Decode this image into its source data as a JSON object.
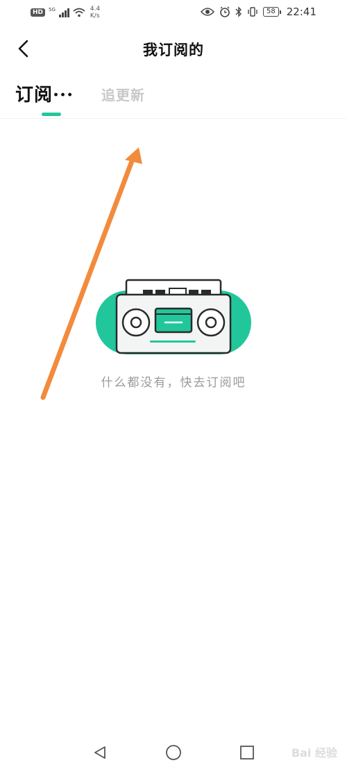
{
  "status_bar": {
    "hd": "HD",
    "network": "5G",
    "speed_value": "4.4",
    "speed_unit": "K/s",
    "battery": "58",
    "time": "22:41",
    "icons": [
      "eye-icon",
      "alarm-icon",
      "bluetooth-icon",
      "vibrate-icon",
      "battery-icon"
    ]
  },
  "header": {
    "title": "我订阅的",
    "back_icon": "chevron-left-icon"
  },
  "tabs": [
    {
      "label": "订阅···",
      "active": true
    },
    {
      "label": "追更新",
      "active": false
    }
  ],
  "empty_state": {
    "illustration": "cassette-player-icon",
    "message": "什么都没有，快去订阅吧"
  },
  "nav_bar": {
    "icons": [
      "nav-back-icon",
      "nav-home-icon",
      "nav-recent-icon"
    ]
  },
  "watermark": "Bai 经验",
  "colors": {
    "accent": "#21c79a",
    "annotation_arrow": "#f28b3c",
    "inactive_tab": "#c8c8c8",
    "empty_text": "#9a9a9a"
  }
}
